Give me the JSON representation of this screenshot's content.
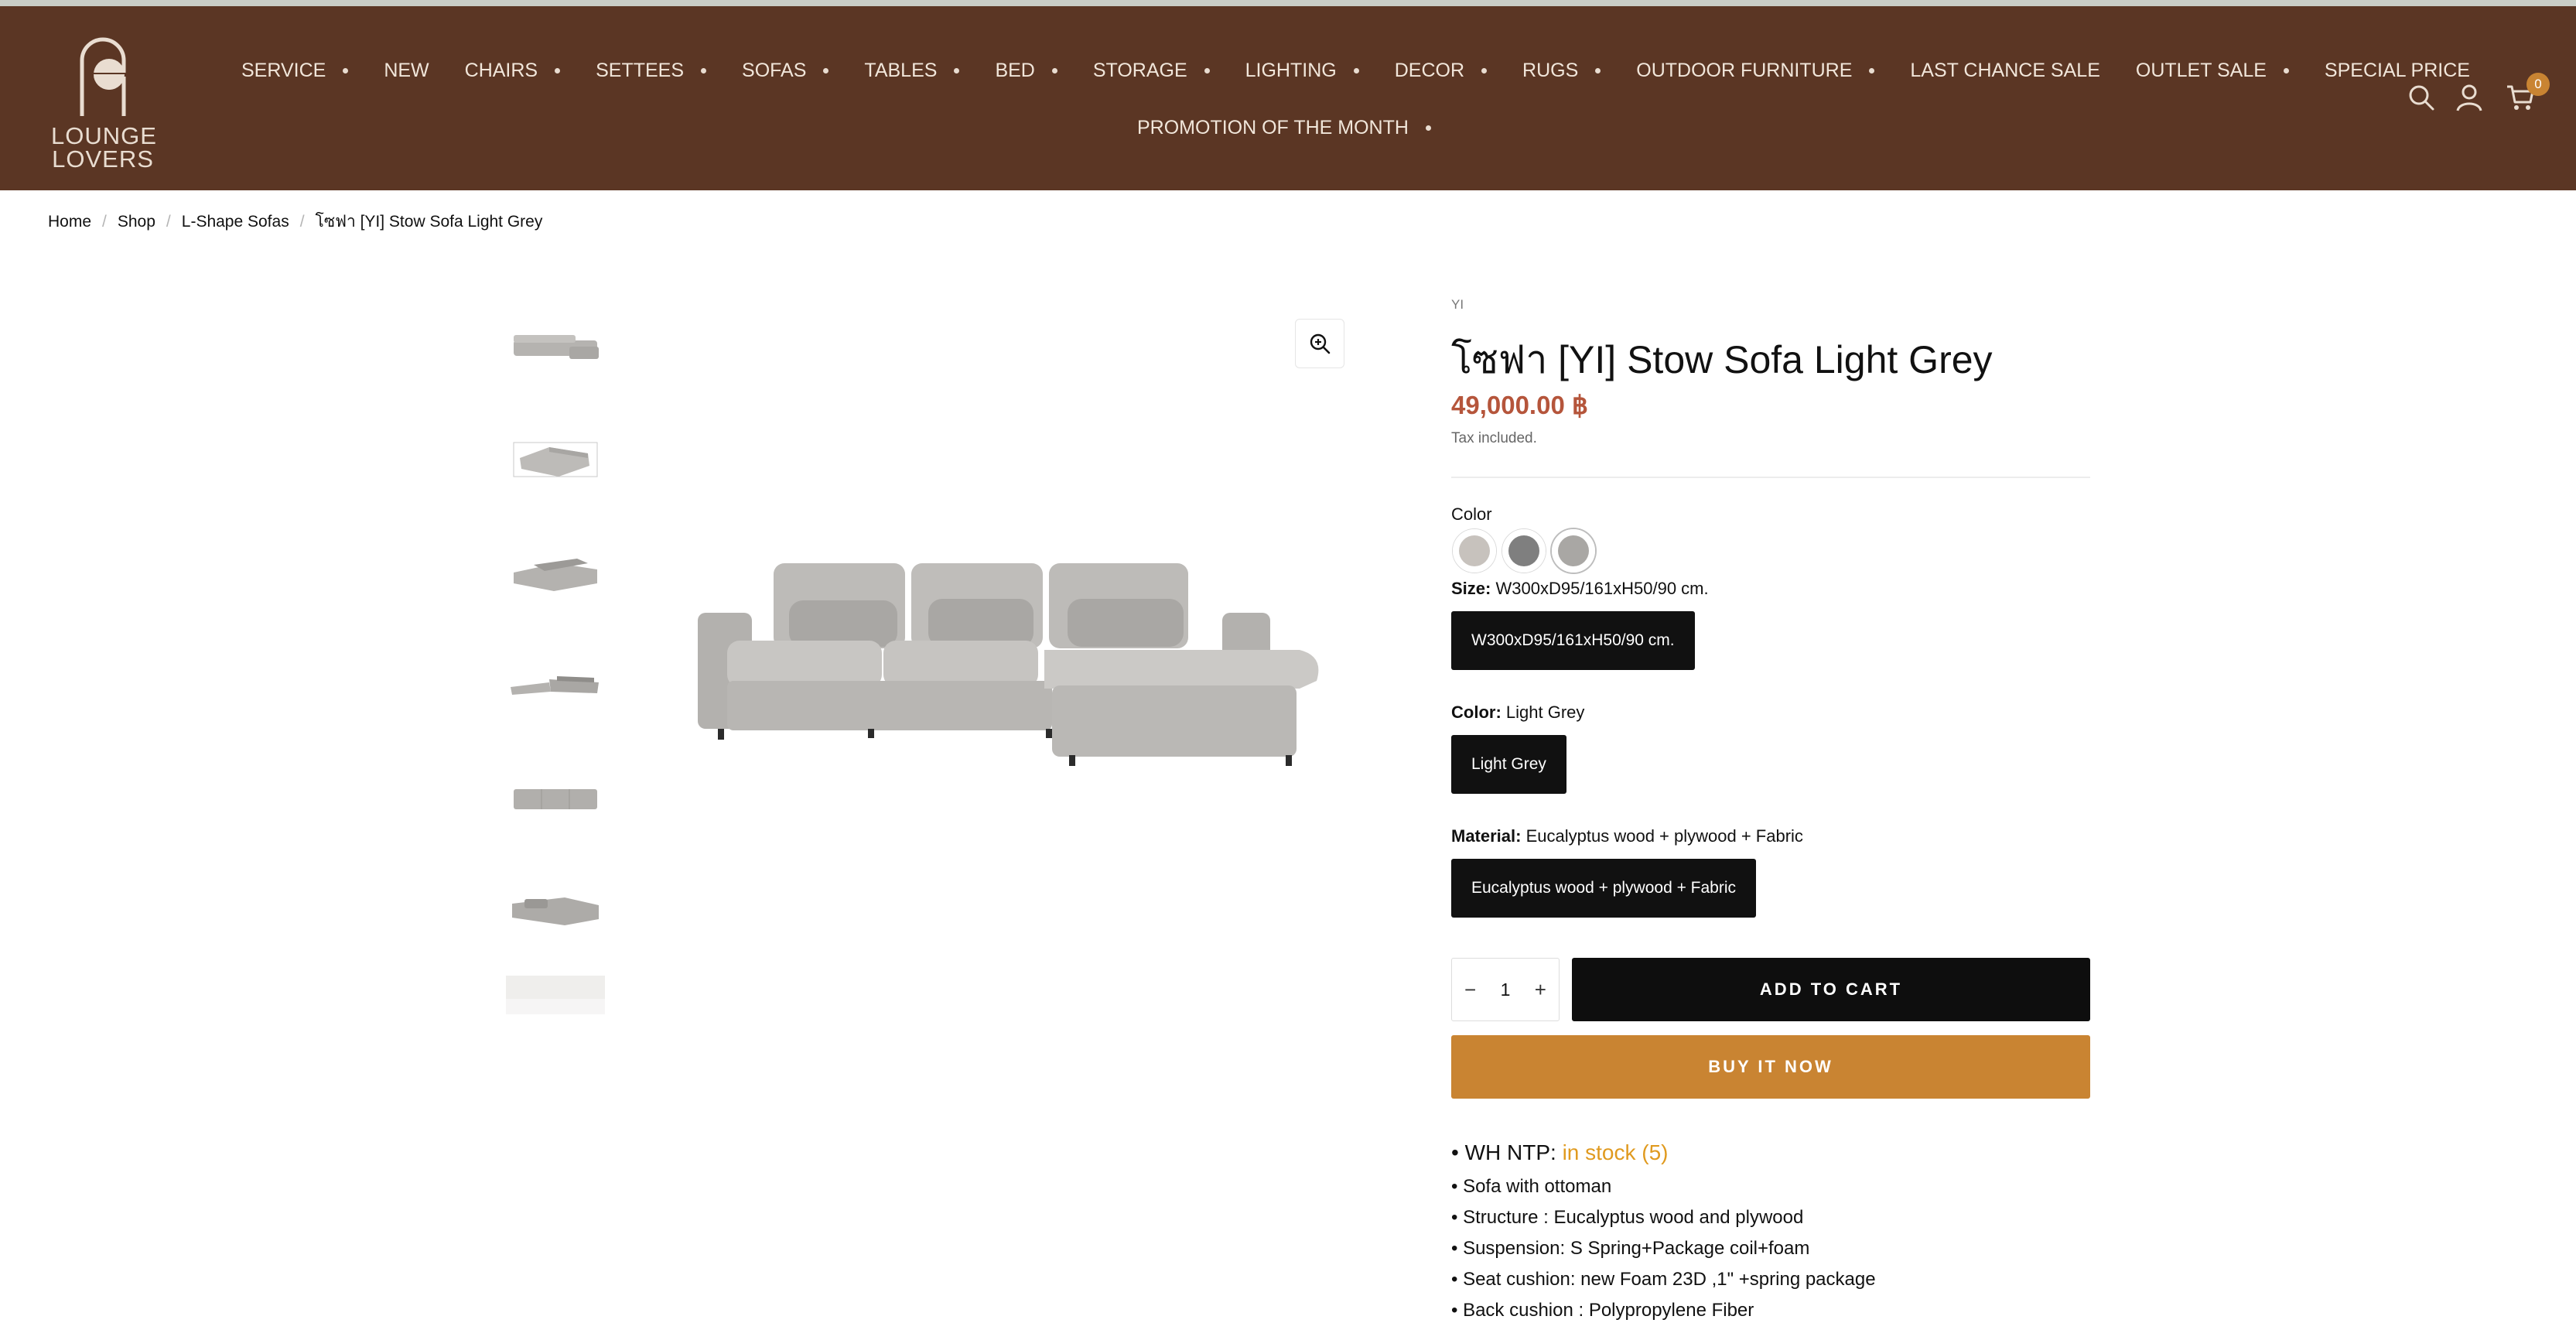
{
  "header": {
    "logo": {
      "line1": "LOUNGE",
      "line2": "LOVERS"
    },
    "nav_row1": [
      {
        "label": "SERVICE",
        "has_dropdown": true
      },
      {
        "label": "NEW",
        "has_dropdown": false
      },
      {
        "label": "CHAIRS",
        "has_dropdown": true
      },
      {
        "label": "SETTEES",
        "has_dropdown": true
      },
      {
        "label": "SOFAS",
        "has_dropdown": true
      },
      {
        "label": "TABLES",
        "has_dropdown": true
      },
      {
        "label": "BED",
        "has_dropdown": true
      },
      {
        "label": "STORAGE",
        "has_dropdown": true
      },
      {
        "label": "LIGHTING",
        "has_dropdown": true
      },
      {
        "label": "DECOR",
        "has_dropdown": true
      },
      {
        "label": "RUGS",
        "has_dropdown": true
      },
      {
        "label": "OUTDOOR FURNITURE",
        "has_dropdown": true
      },
      {
        "label": "LAST CHANCE SALE",
        "has_dropdown": false
      },
      {
        "label": "OUTLET SALE",
        "has_dropdown": true
      },
      {
        "label": "SPECIAL PRICE",
        "has_dropdown": false
      }
    ],
    "nav_row2": [
      {
        "label": "PROMOTION OF THE MONTH",
        "has_dropdown": true
      }
    ],
    "icons": [
      "search-icon",
      "account-icon",
      "cart-icon"
    ],
    "cart_count": "0",
    "colors": {
      "background": "#5b3624",
      "text": "#f1e6da",
      "badge": "#c98432"
    }
  },
  "breadcrumb": {
    "items": [
      "Home",
      "Shop",
      "L-Shape Sofas",
      "โซฟา [YI] Stow Sofa Light Grey"
    ],
    "separator": "/"
  },
  "gallery": {
    "thumbnail_count": 7,
    "zoom_icon": "zoom-in-icon"
  },
  "product": {
    "vendor": "YI",
    "title": "โซฟา [YI] Stow Sofa Light Grey",
    "price": "49,000.00 ฿",
    "tax_note": "Tax included.",
    "color_swatch_label": "Color",
    "swatches": [
      {
        "color": "#c7c2bd",
        "selected": false
      },
      {
        "color": "#7f7f7f",
        "selected": false
      },
      {
        "color": "#a9a7a4",
        "selected": true
      }
    ],
    "size": {
      "label": "Size:",
      "value": "W300xD95/161xH50/90 cm.",
      "option": "W300xD95/161xH50/90 cm."
    },
    "color": {
      "label": "Color:",
      "value": "Light Grey",
      "option": "Light Grey"
    },
    "material": {
      "label": "Material:",
      "value": "Eucalyptus wood + plywood + Fabric",
      "option": "Eucalyptus wood + plywood + Fabric"
    },
    "quantity": {
      "minus": "−",
      "value": "1",
      "plus": "+"
    },
    "add_to_cart": "ADD TO CART",
    "buy_now": "BUY IT NOW",
    "stock": {
      "prefix": "• WH NTP: ",
      "status": "in stock (5)"
    },
    "details": [
      "• Sofa with ottoman",
      "• Structure : Eucalyptus wood and plywood",
      "• Suspension: S Spring+Package coil+foam",
      "• Seat cushion: new Foam  23D ,1\" +spring package",
      "• Back cushion : Polypropylene Fiber"
    ],
    "colors": {
      "price": "#b5553b",
      "buy_now": "#c98432",
      "in_stock": "#e09a1f"
    }
  }
}
